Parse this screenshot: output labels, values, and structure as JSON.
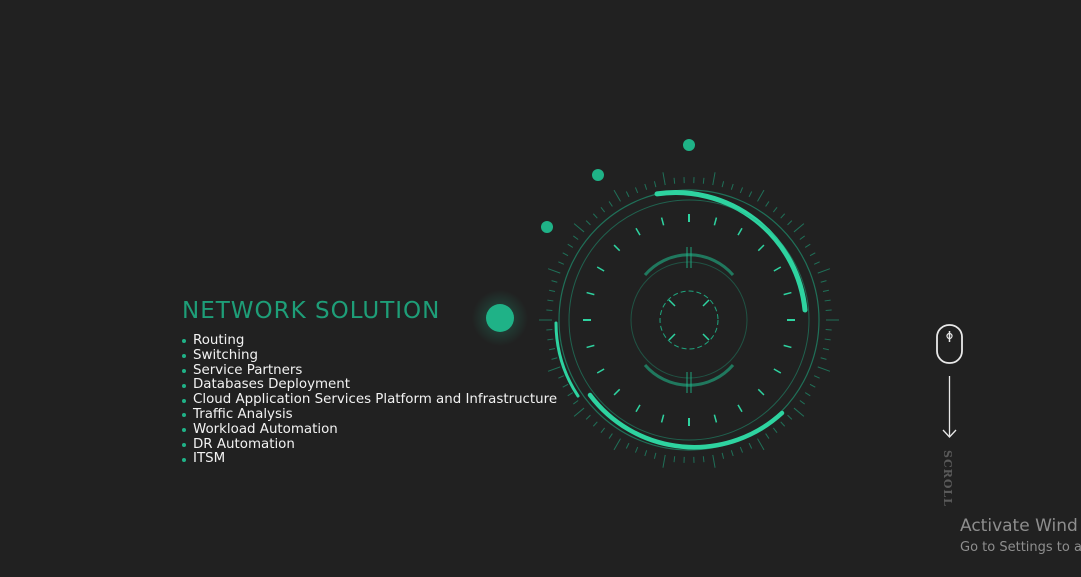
{
  "hero": {
    "title": "NETWORK SOLUTION",
    "services": [
      "Routing",
      "Switching",
      "Service Partners",
      "Databases Deployment",
      "Cloud Application Services Platform and Infrastructure",
      "Traffic Analysis",
      "Workload Automation",
      "DR Automation",
      "ITSM"
    ]
  },
  "scroll": {
    "label": "SCROLL",
    "icon": "mouse-icon"
  },
  "watermark": {
    "title": "Activate Wind",
    "subtitle": "Go to Settings to a"
  },
  "colors": {
    "background": "#212121",
    "accent": "#1fb287",
    "accent_bright": "#2ed3a0",
    "text": "#f2f2f2"
  }
}
